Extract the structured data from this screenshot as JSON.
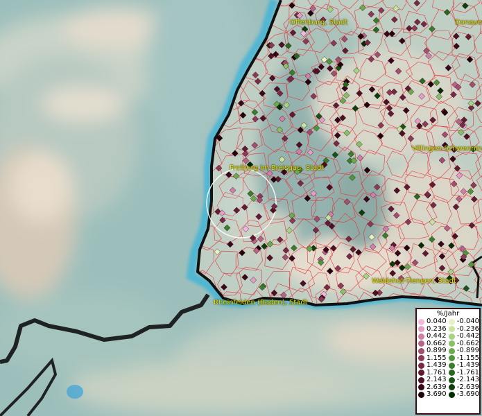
{
  "map": {
    "cities": [
      {
        "name": "Offenburg, Stadt"
      },
      {
        "name": "Donauesch"
      },
      {
        "name": "Villingen-Schwenningen"
      },
      {
        "name": "Freiburg im Breisgau, Stadt"
      },
      {
        "name": "Waldshut-Tiengen, Stadt"
      },
      {
        "name": "Rheinfelden (Baden), Stadt"
      }
    ]
  },
  "legend": {
    "title": "%/Jahr",
    "positive": [
      {
        "label": "0.040",
        "color": "#f3b8dd"
      },
      {
        "label": "0.236",
        "color": "#e49ec6"
      },
      {
        "label": "0.442",
        "color": "#cf80a6"
      },
      {
        "label": "0.662",
        "color": "#b76586"
      },
      {
        "label": "0.899",
        "color": "#a14f6c"
      },
      {
        "label": "1.155",
        "color": "#8c3b56"
      },
      {
        "label": "1.439",
        "color": "#772a43"
      },
      {
        "label": "1.761",
        "color": "#621c32"
      },
      {
        "label": "2.143",
        "color": "#4d1124"
      },
      {
        "label": "2.639",
        "color": "#380818"
      },
      {
        "label": "3.690",
        "color": "#22030c"
      }
    ],
    "negative": [
      {
        "label": "-0.040",
        "color": "#e4f2c4"
      },
      {
        "label": "-0.236",
        "color": "#c7e4a0"
      },
      {
        "label": "-0.442",
        "color": "#a8d382"
      },
      {
        "label": "-0.662",
        "color": "#88c066"
      },
      {
        "label": "-0.899",
        "color": "#6aab4e"
      },
      {
        "label": "-1.155",
        "color": "#4f963b"
      },
      {
        "label": "-1.439",
        "color": "#397f2b"
      },
      {
        "label": "-1.761",
        "color": "#27691e"
      },
      {
        "label": "-2.143",
        "color": "#185413"
      },
      {
        "label": "-2.639",
        "color": "#0c3f0a"
      },
      {
        "label": "-3.690",
        "color": "#042a04"
      }
    ]
  }
}
